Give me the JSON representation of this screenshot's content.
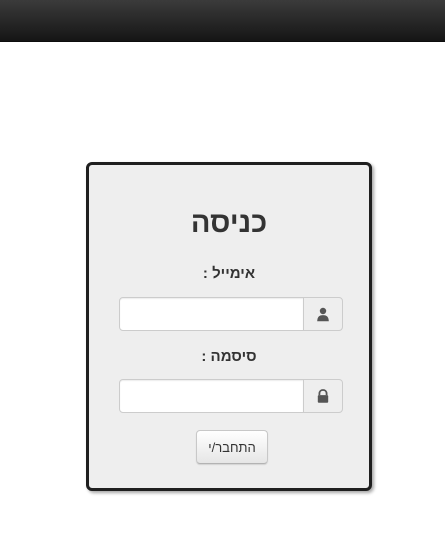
{
  "login": {
    "title": "כניסה",
    "email_label": "אימייל :",
    "email_value": "",
    "email_icon": "user-icon",
    "password_label": "סיסמה :",
    "password_value": "",
    "password_icon": "lock-icon",
    "submit_label": "התחבר/י"
  },
  "colors": {
    "topbar": "#222222",
    "card_background": "#eeeeee",
    "card_border": "#1f1f1f",
    "text": "#333333"
  }
}
